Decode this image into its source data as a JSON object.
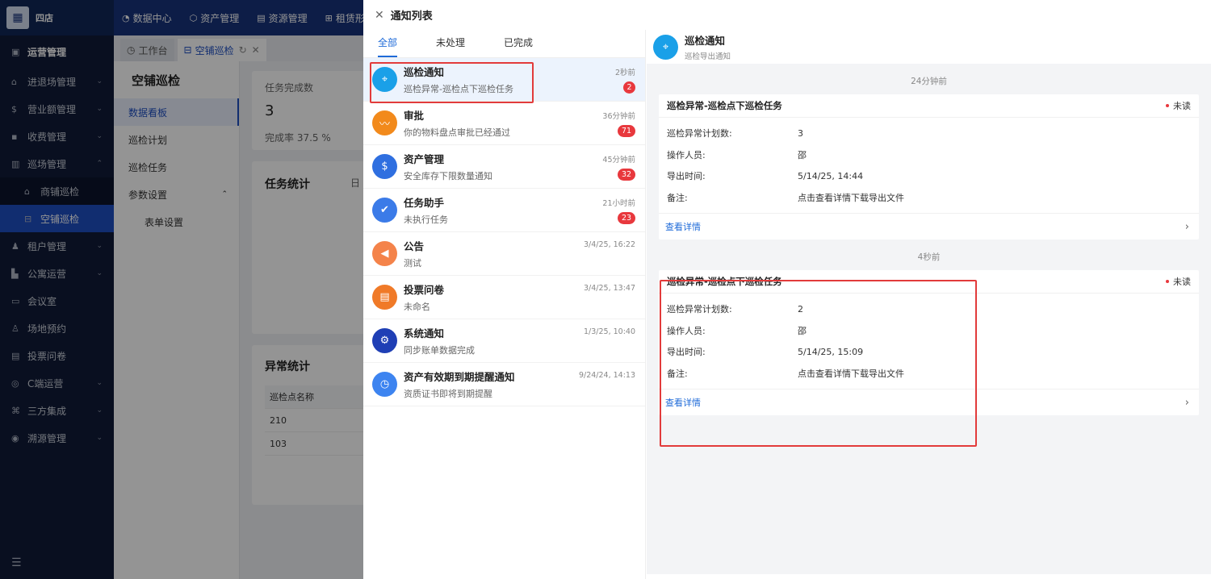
{
  "header": {
    "brand_name": "四店",
    "nav": [
      {
        "icon": "dashboard-icon",
        "label": "数据中心"
      },
      {
        "icon": "asset-icon",
        "label": "资产管理"
      },
      {
        "icon": "resource-icon",
        "label": "资源管理"
      },
      {
        "icon": "lease-icon",
        "label": "租赁形式"
      }
    ]
  },
  "sidebar": {
    "items": [
      {
        "label": "运营管理"
      },
      {
        "label": "进退场管理"
      },
      {
        "label": "营业额管理"
      },
      {
        "label": "收费管理"
      },
      {
        "label": "巡场管理"
      },
      {
        "label": "商铺巡检"
      },
      {
        "label": "空铺巡检"
      },
      {
        "label": "租户管理"
      },
      {
        "label": "公寓运营"
      },
      {
        "label": "会议室"
      },
      {
        "label": "场地预约"
      },
      {
        "label": "投票问卷"
      },
      {
        "label": "C端运营"
      },
      {
        "label": "三方集成"
      },
      {
        "label": "溯源管理"
      }
    ]
  },
  "tabs": [
    {
      "label": "工作台"
    },
    {
      "label": "空铺巡检"
    }
  ],
  "subnav": {
    "title": "空铺巡检",
    "items": [
      {
        "label": "数据看板"
      },
      {
        "label": "巡检计划"
      },
      {
        "label": "巡检任务"
      },
      {
        "label": "参数设置"
      },
      {
        "label": "表单设置"
      }
    ]
  },
  "content": {
    "task_done_label": "任务完成数",
    "task_done_value": "3",
    "completion_rate": "完成率  37.5 %",
    "task_stats_title": "任务统计",
    "task_stats_trailing": "日",
    "anomaly_title": "异常统计",
    "anomaly_table_header": "巡检点名称",
    "anomaly_rows": [
      "210",
      "103"
    ]
  },
  "drawer": {
    "title": "通知列表",
    "filter_tabs": [
      "全部",
      "未处理",
      "已完成"
    ],
    "notifications": [
      {
        "title": "巡检通知",
        "subtitle": "巡检异常-巡检点下巡检任务",
        "time": "2秒前",
        "badge": "2",
        "color": "#1aa0e8",
        "icon": "location-pin-icon"
      },
      {
        "title": "审批",
        "subtitle": "你的物料盘点审批已经通过",
        "time": "36分钟前",
        "badge": "71",
        "color": "#f28a1c",
        "icon": "approval-icon"
      },
      {
        "title": "资产管理",
        "subtitle": "安全库存下限数量通知",
        "time": "45分钟前",
        "badge": "32",
        "color": "#2f6fe0",
        "icon": "asset-stack-icon"
      },
      {
        "title": "任务助手",
        "subtitle": "未执行任务",
        "time": "21小时前",
        "badge": "23",
        "color": "#3b7be8",
        "icon": "checkmark-icon"
      },
      {
        "title": "公告",
        "subtitle": "测试",
        "time": "3/4/25, 16:22",
        "badge": "",
        "color": "#f4834a",
        "icon": "megaphone-icon"
      },
      {
        "title": "投票问卷",
        "subtitle": "未命名",
        "time": "3/4/25, 13:47",
        "badge": "",
        "color": "#f07a28",
        "icon": "survey-icon"
      },
      {
        "title": "系统通知",
        "subtitle": "同步账单数据完成",
        "time": "1/3/25, 10:40",
        "badge": "",
        "color": "#1f3fb5",
        "icon": "system-icon"
      },
      {
        "title": "资产有效期到期提醒通知",
        "subtitle": "资质证书即将到期提醒",
        "time": "9/24/24, 14:13",
        "badge": "",
        "color": "#3d84f0",
        "icon": "expiry-icon"
      }
    ],
    "detail": {
      "title": "巡检通知",
      "subtitle": "巡检导出通知",
      "groups": [
        {
          "time": "24分钟前",
          "card_title": "巡检异常-巡检点下巡检任务",
          "status": "未读",
          "rows": [
            {
              "k": "巡检异常计划数:",
              "v": "3"
            },
            {
              "k": "操作人员:",
              "v": "邵"
            },
            {
              "k": "导出时间:",
              "v": "5/14/25, 14:44"
            },
            {
              "k": "备注:",
              "v": "点击查看详情下载导出文件"
            }
          ],
          "link": "查看详情"
        },
        {
          "time": "4秒前",
          "card_title": "巡检异常-巡检点下巡检任务",
          "status": "未读",
          "rows": [
            {
              "k": "巡检异常计划数:",
              "v": "2"
            },
            {
              "k": "操作人员:",
              "v": "邵"
            },
            {
              "k": "导出时间:",
              "v": "5/14/25, 15:09"
            },
            {
              "k": "备注:",
              "v": "点击查看详情下载导出文件"
            }
          ],
          "link": "查看详情"
        }
      ]
    }
  }
}
